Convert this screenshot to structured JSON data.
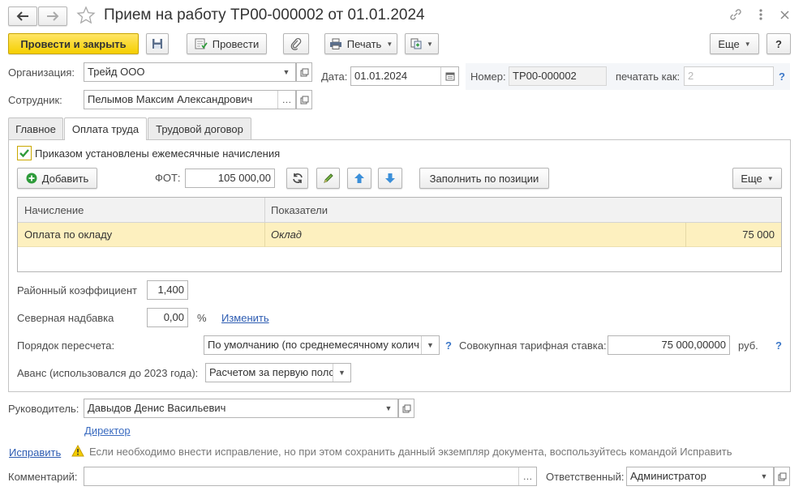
{
  "window": {
    "title": "Прием на работу ТР00-000002 от 01.01.2024"
  },
  "toolbar": {
    "post_close_label": "Провести и закрыть",
    "post_label": "Провести",
    "print_label": "Печать",
    "more_label": "Еще",
    "help_label": "?"
  },
  "header": {
    "org_label": "Организация:",
    "org_value": "Трейд ООО",
    "date_label": "Дата:",
    "date_value": "01.01.2024",
    "number_label": "Номер:",
    "number_value": "ТР00-000002",
    "print_as_label": "печатать как:",
    "print_as_placeholder": "2",
    "help_label": "?",
    "employee_label": "Сотрудник:",
    "employee_value": "Пелымов Максим Александрович"
  },
  "tabs": [
    {
      "label": "Главное"
    },
    {
      "label": "Оплата труда"
    },
    {
      "label": "Трудовой договор"
    }
  ],
  "pay": {
    "monthly_checkbox_label": "Приказом установлены ежемесячные начисления",
    "add_label": "Добавить",
    "fot_label": "ФОТ:",
    "fot_value": "105 000,00",
    "fill_label": "Заполнить по позиции",
    "more_label": "Еще",
    "table": {
      "columns": [
        "Начисление",
        "Показатели"
      ],
      "rows": [
        {
          "accrual": "Оплата по окладу",
          "indicator": "Оклад",
          "value": "75 000"
        }
      ]
    },
    "district_coef_label": "Районный коэффициент",
    "district_coef_value": "1,400",
    "northern_label": "Северная надбавка",
    "northern_value": "0,00",
    "percent_sign": "%",
    "change_link": "Изменить",
    "recalc_label": "Порядок пересчета:",
    "recalc_value": "По умолчанию (по среднемесячному колич",
    "total_rate_label": "Совокупная тарифная ставка:",
    "total_rate_value": "75 000,00000",
    "currency": "руб.",
    "help_label": "?",
    "advance_label": "Аванс (использовался до 2023 года):",
    "advance_value": "Расчетом за первую полс"
  },
  "footer": {
    "manager_label": "Руководитель:",
    "manager_value": "Давыдов Денис Васильевич",
    "director_link": "Директор",
    "fix_link": "Исправить",
    "fix_hint": "Если необходимо внести исправление, но при этом сохранить данный экземпляр документа, воспользуйтесь командой Исправить",
    "comment_label": "Комментарий:",
    "responsible_label": "Ответственный:",
    "responsible_value": "Администратор"
  },
  "colors": {
    "accent_yellow": "#f5cf00",
    "selected_row": "#fdf0bf",
    "link_blue": "#2d5cb2",
    "checkbox_green": "#2e9b3a"
  }
}
